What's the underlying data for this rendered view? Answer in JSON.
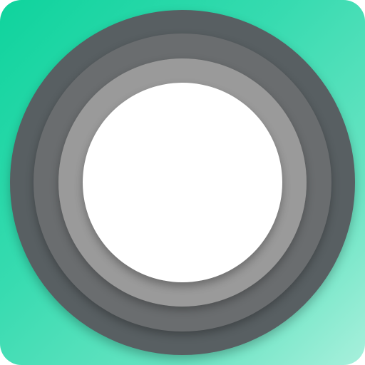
{
  "app_icon": {
    "icon_name": "assistive-touch-icon",
    "colors": {
      "background_top_left": "#0fd39d",
      "background_bottom_right": "#a8f0dc",
      "ring_outer": "#585f62",
      "ring_second": "#6a6d6f",
      "ring_third": "#7b7b7b",
      "ring_fourth": "#9a9a9a",
      "center": "#ffffff"
    }
  }
}
